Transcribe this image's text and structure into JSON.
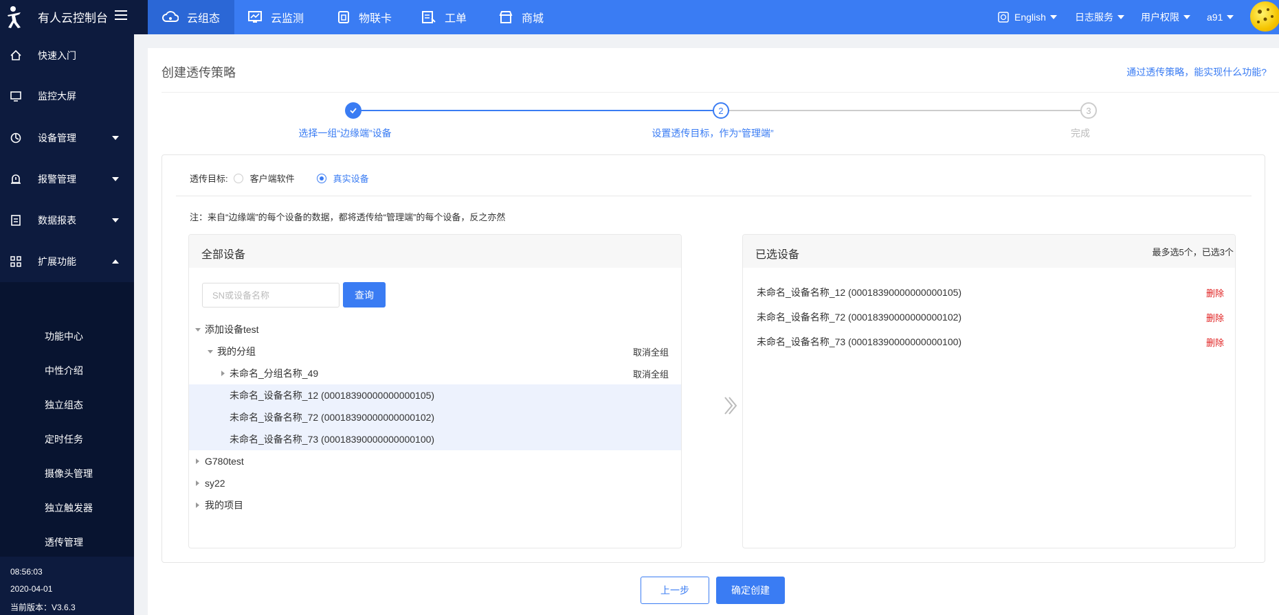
{
  "brand": {
    "title": "有人云控制台"
  },
  "nav": [
    {
      "label": "云组态",
      "icon": "cloud-icon",
      "active": true
    },
    {
      "label": "云监测",
      "icon": "monitor-chart-icon"
    },
    {
      "label": "物联卡",
      "icon": "sim-card-icon"
    },
    {
      "label": "工单",
      "icon": "ticket-icon"
    },
    {
      "label": "商城",
      "icon": "shop-icon"
    }
  ],
  "top_right": {
    "language": "English",
    "log_service": "日志服务",
    "user_permissions": "用户权限",
    "user": "a91"
  },
  "sidebar": {
    "items": [
      {
        "label": "快速入门",
        "icon": "home-icon"
      },
      {
        "label": "监控大屏",
        "icon": "screen-icon"
      },
      {
        "label": "设备管理",
        "icon": "device-icon",
        "expandable": true
      },
      {
        "label": "报警管理",
        "icon": "alarm-icon",
        "expandable": true
      },
      {
        "label": "数据报表",
        "icon": "report-icon",
        "expandable": true
      },
      {
        "label": "扩展功能",
        "icon": "apps-icon",
        "expanded": true
      }
    ],
    "sub_items": [
      "功能中心",
      "中性介绍",
      "独立组态",
      "定时任务",
      "摄像头管理",
      "独立触发器",
      "透传管理"
    ],
    "time": "08:56:03",
    "date": "2020-04-01",
    "version": "当前版本：V3.6.3"
  },
  "page": {
    "title": "创建透传策略",
    "help_link": "通过透传策略，能实现什么功能?"
  },
  "steps": [
    {
      "label": "选择一组“边缘端”设备",
      "status": "done",
      "num": "1"
    },
    {
      "label": "设置透传目标，作为“管理端”",
      "status": "current",
      "num": "2"
    },
    {
      "label": "完成",
      "status": "pending",
      "num": "3"
    }
  ],
  "target": {
    "label": "透传目标:",
    "options": [
      "客户端软件",
      "真实设备"
    ],
    "selected": "真实设备"
  },
  "note": "注：来自“边缘端”的每个设备的数据，都将透传给“管理端”的每个设备，反之亦然",
  "all_devices": {
    "header": "全部设备",
    "search_placeholder": "SN或设备名称",
    "search_button": "查询",
    "tree": [
      {
        "label": "添加设备test",
        "level": 0,
        "toggle": "down"
      },
      {
        "label": "我的分组",
        "level": 1,
        "toggle": "down",
        "action": "取消全组"
      },
      {
        "label": "未命名_分组名称_49",
        "level": 2,
        "toggle": "right",
        "action": "取消全组"
      },
      {
        "label": "未命名_设备名称_12 (00018390000000000105)",
        "level": 2,
        "selected": true
      },
      {
        "label": "未命名_设备名称_72 (00018390000000000102)",
        "level": 2,
        "selected": true
      },
      {
        "label": "未命名_设备名称_73 (00018390000000000100)",
        "level": 2,
        "selected": true
      },
      {
        "label": "G780test",
        "level": 0,
        "toggle": "right"
      },
      {
        "label": "sy22",
        "level": 0,
        "toggle": "right"
      },
      {
        "label": "我的项目",
        "level": 0,
        "toggle": "right"
      }
    ]
  },
  "selected_devices": {
    "header": "已选设备",
    "limit_text": "最多选5个，已选3个",
    "delete_label": "删除",
    "items": [
      "未命名_设备名称_12  (00018390000000000105)",
      "未命名_设备名称_72  (00018390000000000102)",
      "未命名_设备名称_73  (00018390000000000100)"
    ]
  },
  "footer_buttons": {
    "prev": "上一步",
    "create": "确定创建"
  },
  "colors": {
    "primary": "#3a7cf3",
    "sidebar": "#0d1b3e",
    "danger": "#e02020"
  }
}
